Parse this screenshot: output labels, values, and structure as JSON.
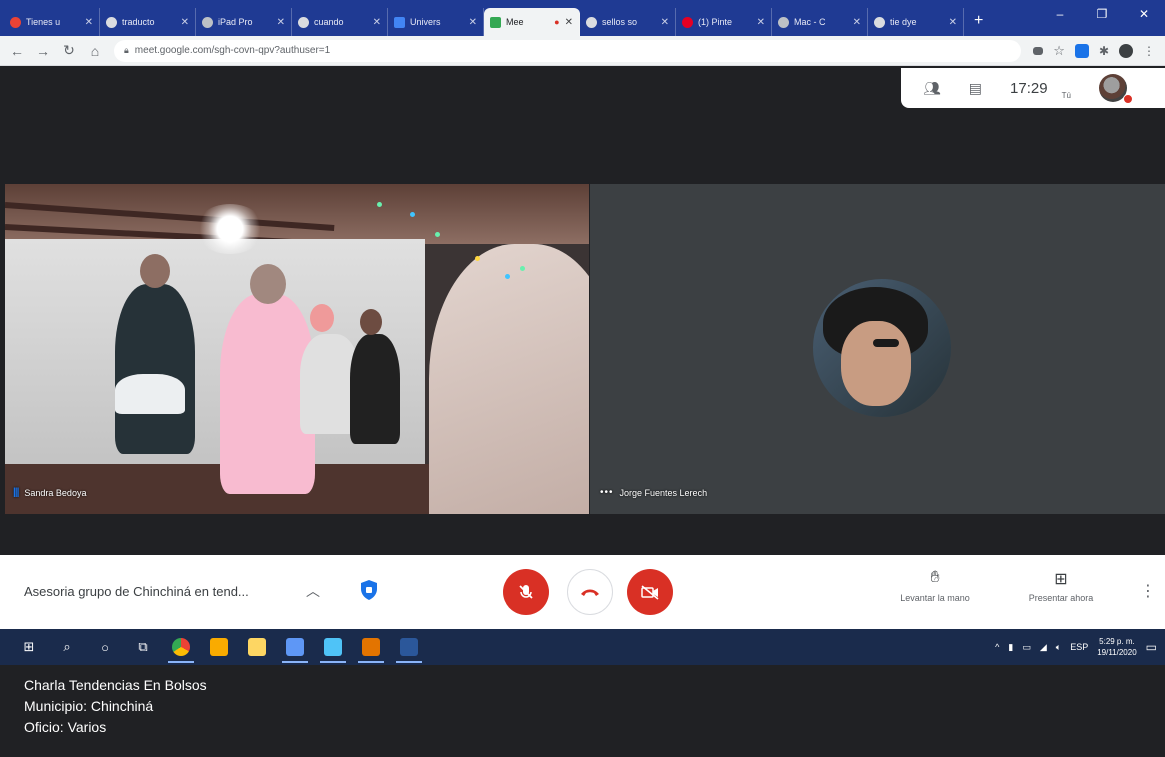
{
  "browser": {
    "tabs": [
      {
        "title": "Tienes u",
        "icon_color": "#ea4335",
        "active": false
      },
      {
        "title": "traducto",
        "icon_color": "#dadce0",
        "active": false
      },
      {
        "title": "iPad Pro",
        "icon_color": "#bdc1c6",
        "active": false
      },
      {
        "title": "cuando",
        "icon_color": "#dadce0",
        "active": false
      },
      {
        "title": "Univers",
        "icon_color": "#4285f4",
        "active": false
      },
      {
        "title": "Mee",
        "icon_color": "#34a853",
        "active": true
      },
      {
        "title": "sellos so",
        "icon_color": "#dadce0",
        "active": false
      },
      {
        "title": "(1) Pinte",
        "icon_color": "#e60023",
        "active": false
      },
      {
        "title": "Mac - C",
        "icon_color": "#bdc1c6",
        "active": false
      },
      {
        "title": "tie dye",
        "icon_color": "#dadce0",
        "active": false
      }
    ],
    "new_tab": "+",
    "url": "meet.google.com/sgh-covn-qpv?authuser=1",
    "window_controls": [
      "–",
      "❐",
      "✕"
    ]
  },
  "meet": {
    "time": "17:29",
    "you_label": "Tú",
    "participants": [
      {
        "name": "Sandra Bedoya",
        "speaking": true
      },
      {
        "name": "Jorge Fuentes Lerech",
        "speaking": false
      }
    ],
    "meeting_title": "Asesoria grupo de Chinchiná en tend...",
    "raise_hand_label": "Levantar la mano",
    "present_label": "Presentar ahora",
    "colors": {
      "danger": "#d93025",
      "accent": "#1a73e8"
    }
  },
  "taskbar": {
    "tray_lang": "ESP",
    "clock_time": "5:29 p. m.",
    "clock_date": "19/11/2020"
  },
  "caption": {
    "line1": "Charla Tendencias En Bolsos",
    "line2": "Municipio: Chinchiná",
    "line3": "Oficio: Varios"
  }
}
